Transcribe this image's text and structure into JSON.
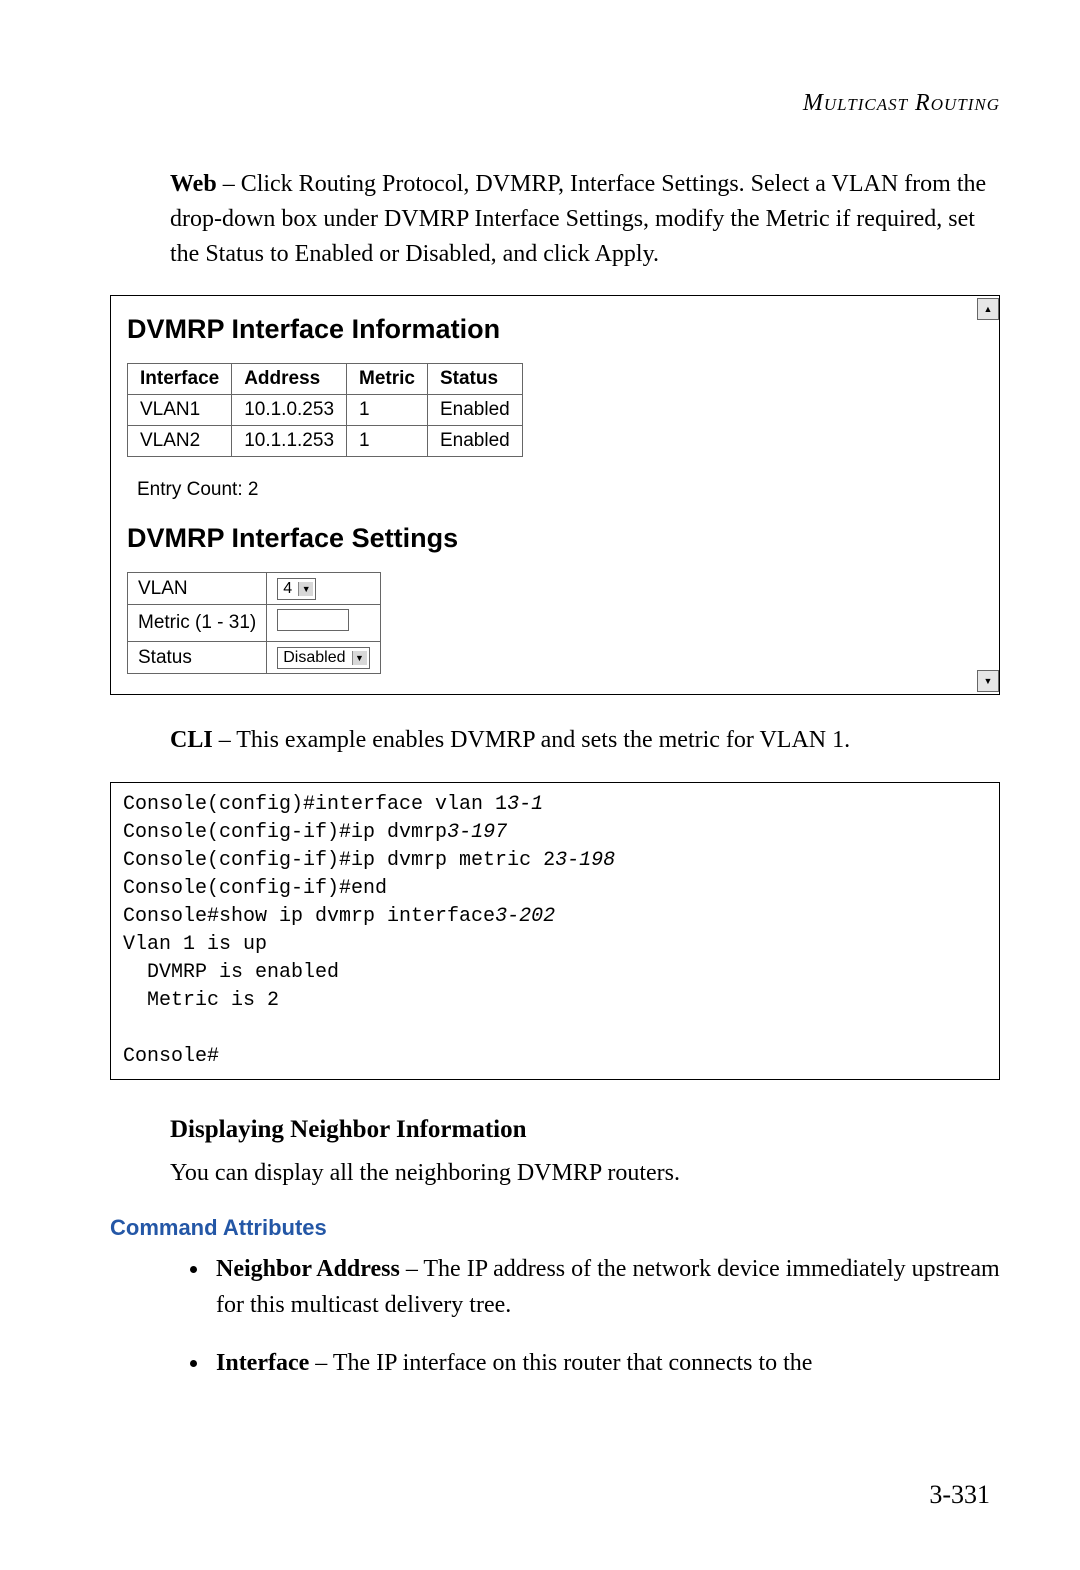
{
  "header": {
    "running": "Multicast Routing"
  },
  "web_para": {
    "lead": "Web",
    "text": " – Click Routing Protocol, DVMRP, Interface Settings. Select a VLAN from the drop-down box under DVMRP Interface Settings, modify the Metric if required, set the Status to Enabled or Disabled, and click Apply."
  },
  "panel": {
    "info_title": "DVMRP Interface Information",
    "table": {
      "headers": [
        "Interface",
        "Address",
        "Metric",
        "Status"
      ],
      "rows": [
        [
          "VLAN1",
          "10.1.0.253",
          "1",
          "Enabled"
        ],
        [
          "VLAN2",
          "10.1.1.253",
          "1",
          "Enabled"
        ]
      ]
    },
    "entry_count_label": "Entry Count: 2",
    "settings_title": "DVMRP Interface Settings",
    "settings_rows": {
      "vlan_label": "VLAN",
      "vlan_value": "4",
      "metric_label": "Metric (1 - 31)",
      "metric_value": "",
      "status_label": "Status",
      "status_value": "Disabled"
    }
  },
  "cli_para": {
    "lead": "CLI",
    "text": " – This example enables DVMRP and sets the metric for VLAN 1."
  },
  "cli": {
    "l1a": "Console(config)#interface vlan 1",
    "l1b": "3-1",
    "l2a": "Console(config-if)#ip dvmrp",
    "l2b": "3-197",
    "l3a": "Console(config-if)#ip dvmrp metric 2",
    "l3b": "3-198",
    "l4": "Console(config-if)#end",
    "l5a": "Console#show ip dvmrp interface",
    "l5b": "3-202",
    "l6": "Vlan 1 is up",
    "l7": "  DVMRP is enabled",
    "l8": "  Metric is 2",
    "l9": "",
    "l10": "Console#"
  },
  "neighbor": {
    "heading": "Displaying Neighbor Information",
    "intro": "You can display all the neighboring DVMRP routers.",
    "cmd_attr_label": "Command Attributes",
    "attrs": [
      {
        "name": "Neighbor Address",
        "desc": " – The IP address of the network device immediately upstream for this multicast delivery tree."
      },
      {
        "name": "Interface",
        "desc": " – The IP interface on this router that connects to the"
      }
    ]
  },
  "page_number": "3-331"
}
